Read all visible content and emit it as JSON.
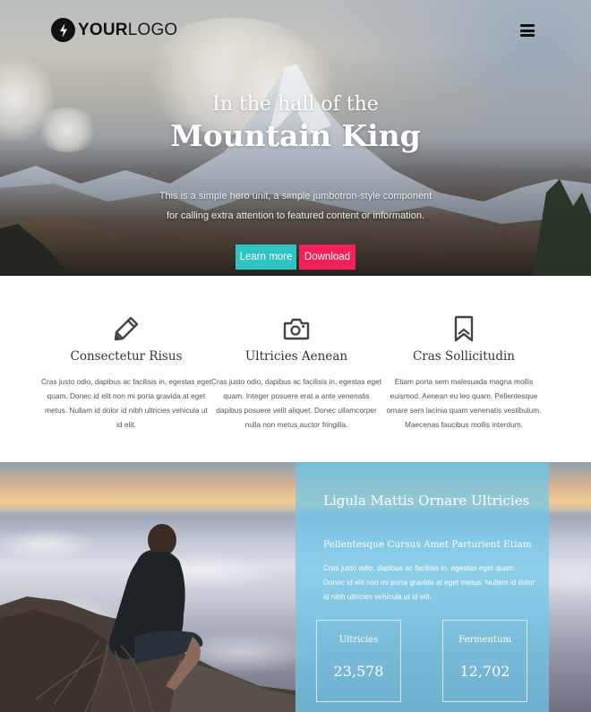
{
  "header": {
    "logo_bold": "YOUR",
    "logo_light": "LOGO",
    "logo_icon": "lightning-bolt-icon",
    "menu_icon": "hamburger-menu-icon"
  },
  "hero": {
    "subtitle": "In the hall of the",
    "title": "Mountain King",
    "description": "This is a simple hero unit, a simple jumbotron-style component for calling extra attention to featured content or information.",
    "buttons": [
      {
        "label": "Learn more",
        "color": "#2ec4c4"
      },
      {
        "label": "Download",
        "color": "#f2215a"
      }
    ]
  },
  "features": [
    {
      "icon": "pencil-icon",
      "title": "Consectetur Risus",
      "text": "Cras justo odio, dapibus ac facilisis in, egestas eget quam. Donec id elit non mi porta gravida at eget metus. Nullam id dolor id nibh ultricies vehicula ut id elit."
    },
    {
      "icon": "camera-icon",
      "title": "Ultricies Aenean",
      "text": "Cras justo odio, dapibus ac facilisis in, egestas eget quam. Integer posuere erat a ante venenatis dapibus posuere velit aliquet. Donec ullamcorper nulla non metus auctor fringilla."
    },
    {
      "icon": "bookmark-icon",
      "title": "Cras Sollicitudin",
      "text": "Etiam porta sem malesuada magna mollis euismod. Aenean eu leo quam. Pellentesque ornare sem lacinia quam venenatis vestibulum. Maecenas faucibus mollis interdum."
    }
  ],
  "showcase": {
    "title": "Ligula Mattis Ornare Ultricies",
    "subtitle": "Pellentesque Cursus Amet Parturient Etiam",
    "text": "Cras justo odio, dapibus ac facilisis in, egestas eget quam. Donec id elit non mi porta gravida at eget metus. Nullam id dolor id nibh ultricies vehicula ut id elit.",
    "overlay_color": "#6ec8eb",
    "stats": [
      {
        "label": "Ultricies",
        "value": "23,578"
      },
      {
        "label": "Fermentum",
        "value": "12,702"
      }
    ]
  }
}
